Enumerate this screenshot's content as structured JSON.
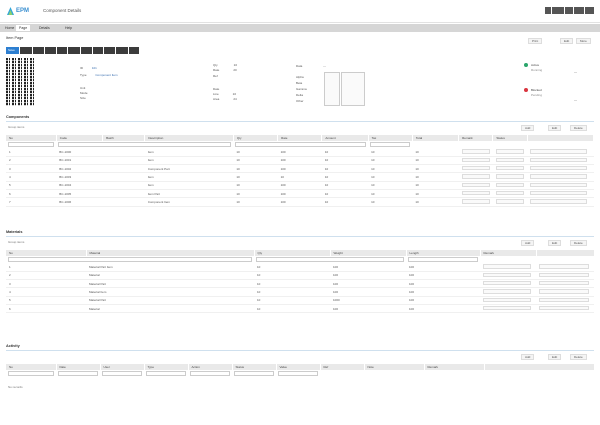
{
  "app": {
    "logo_text": "EPM",
    "title": "Component Details"
  },
  "header_actions": [
    "",
    "",
    "",
    "",
    ""
  ],
  "menu": {
    "tabs": [
      "Home",
      "Page",
      "Details",
      "Help"
    ],
    "active": 1
  },
  "page": {
    "title": "Item Page",
    "tools_right": [
      "Print",
      "Edit",
      "More"
    ]
  },
  "toolbar": {
    "buttons": [
      "Save",
      "",
      "",
      "",
      "",
      "",
      "",
      "",
      "",
      "",
      ""
    ]
  },
  "info": {
    "col1": [
      [
        "ID",
        "101"
      ],
      [
        "Type",
        "Component Item"
      ],
      [
        "Unit",
        ""
      ],
      [
        "Mode",
        ""
      ],
      [
        "Size",
        ""
      ]
    ],
    "col2": [
      [
        "Qty",
        "10"
      ],
      [
        "Rate",
        "20"
      ],
      [
        "Ref",
        ""
      ],
      [
        "Date",
        ""
      ],
      [
        "Line",
        "10"
      ],
      [
        "Area",
        "24"
      ]
    ],
    "col3": {
      "label": "Data",
      "rows": [
        "Alpha",
        "Beta",
        "Gamma",
        "Delta",
        "Other"
      ]
    },
    "status": [
      {
        "label": "Active",
        "sub": "Running",
        "value": "—",
        "color": "#2aa56b"
      },
      {
        "label": "Blocked",
        "sub": "Pending",
        "value": "—",
        "color": "#d9343f"
      }
    ]
  },
  "section1": {
    "title": "Components",
    "caption": "Group items",
    "actions": [
      "Add",
      "Edit",
      "Delete"
    ],
    "columns": [
      "No",
      "Code",
      "Batch",
      "Description",
      "Qty",
      "Rate",
      "Amount",
      "Tax",
      "Total",
      "Remark",
      "Status",
      ""
    ],
    "rows": [
      [
        "1",
        "BC-1000",
        "",
        "Item",
        "10",
        "100",
        "10",
        "10",
        "10"
      ],
      [
        "2",
        "BC-1001",
        "",
        "Item",
        "10",
        "100",
        "10",
        "10",
        "10"
      ],
      [
        "3",
        "BC-1002",
        "",
        "Component Part",
        "10",
        "100",
        "10",
        "10",
        "10"
      ],
      [
        "4",
        "BC-1003",
        "",
        "Item",
        "10",
        "10",
        "10",
        "10",
        "10"
      ],
      [
        "5",
        "BC-1004",
        "",
        "Item",
        "10",
        "100",
        "10",
        "10",
        "10"
      ],
      [
        "6",
        "BC-1005",
        "",
        "Item Part",
        "10",
        "100",
        "10",
        "10",
        "10"
      ],
      [
        "7",
        "BC-1006",
        "",
        "Component Item",
        "10",
        "100",
        "10",
        "10",
        "10"
      ]
    ]
  },
  "section2": {
    "title": "Materials",
    "caption": "Group items",
    "actions": [
      "Add",
      "Edit",
      "Delete"
    ],
    "columns": [
      "No",
      "Material",
      "Qty",
      "Weight",
      "Length",
      "Remark",
      ""
    ],
    "rows": [
      [
        "1",
        "Material Part Item",
        "10",
        "100",
        "100"
      ],
      [
        "2",
        "Material",
        "10",
        "100",
        "100"
      ],
      [
        "3",
        "Material Part",
        "10",
        "100",
        "100"
      ],
      [
        "4",
        "Material Item",
        "10",
        "100",
        "100"
      ],
      [
        "5",
        "Material Part",
        "10",
        "1000",
        "100"
      ],
      [
        "6",
        "Material",
        "10",
        "100",
        "100"
      ]
    ]
  },
  "section3": {
    "title": "Activity",
    "caption": "No records",
    "actions": [
      "Add",
      "Edit",
      "Delete"
    ],
    "columns": [
      "No",
      "Date",
      "User",
      "Type",
      "Action",
      "Status",
      "Value",
      "Ref",
      "Note",
      "Remark",
      ""
    ]
  }
}
